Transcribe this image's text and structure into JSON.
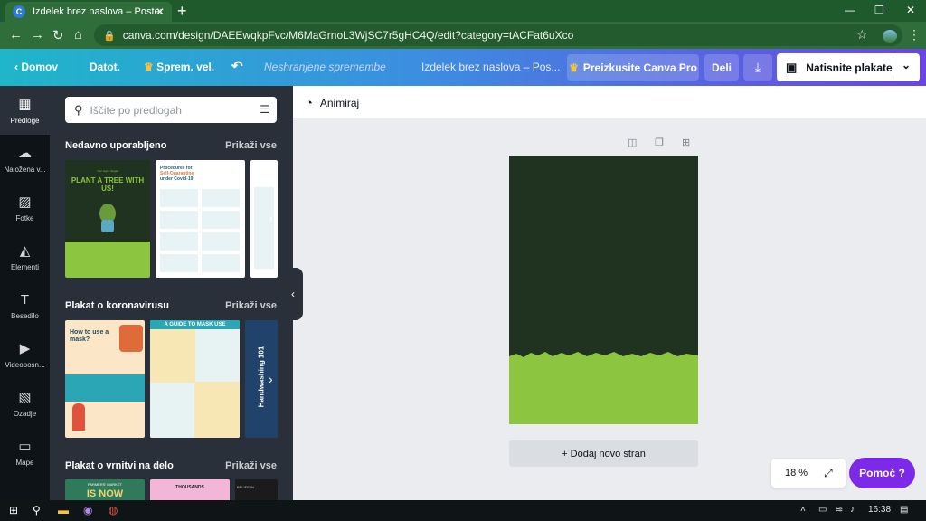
{
  "browser": {
    "tab_title": "Izdelek brez naslova – Poster",
    "tab_favicon": "C",
    "url": "canva.com/design/DAEEwqkpFvc/M6MaGrnoL3WjSC7r5gHC4Q/edit?category=tACFat6uXco",
    "colors": {
      "tabstrip": "#1e5a2c",
      "toolbar": "#2f6e3b"
    }
  },
  "toolbar": {
    "home": "Domov",
    "file": "Datot.",
    "resize": "Sprem. vel.",
    "save_status": "Neshranjene spremembe",
    "doc_title": "Izdelek brez naslova – Pos...",
    "try_pro": "Preizkusite Canva Pro",
    "share": "Deli",
    "print": "Natisnite plakate"
  },
  "rail": [
    {
      "label": "Predloge",
      "icon": "templates-icon"
    },
    {
      "label": "Naložena v...",
      "icon": "upload-cloud-icon"
    },
    {
      "label": "Fotke",
      "icon": "photo-icon"
    },
    {
      "label": "Elementi",
      "icon": "elements-icon"
    },
    {
      "label": "Besedilo",
      "icon": "text-icon"
    },
    {
      "label": "Videoposn...",
      "icon": "video-icon"
    },
    {
      "label": "Ozadje",
      "icon": "background-icon"
    },
    {
      "label": "Mape",
      "icon": "folder-icon"
    }
  ],
  "panel": {
    "search_placeholder": "Iščite po predlogah",
    "sections": [
      {
        "title": "Nedavno uporabljeno",
        "show_all": "Prikaži vse"
      },
      {
        "title": "Plakat o koronavirusu",
        "show_all": "Prikaži vse"
      },
      {
        "title": "Plakat o vrnitvi na delo",
        "show_all": "Prikaži vse"
      }
    ],
    "thumbs": {
      "tree_tag": "Your logo / slogan",
      "tree_title": "PLANT A TREE WITH US!",
      "covid_title": "Procedures for",
      "covid_title2": "Self-Quarantine",
      "covid_title3": "under Covid-19",
      "mask_title": "How to use a mask?",
      "guide_title": "A GUIDE TO MASK USE",
      "hand_title": "Handwashing 101",
      "work1": "IS NOW",
      "work1_tag": "FARMERS' MARKET",
      "work2": "THOUSANDS",
      "work3": "BELIEF IN"
    }
  },
  "canvas": {
    "animate": "Animiraj",
    "add_page": "+ Dodaj novo stran",
    "zoom": "18 %",
    "help": "Pomoč ?",
    "colors": {
      "page_dark": "#1f3320",
      "page_green": "#8cc53f"
    }
  },
  "taskbar": {
    "time": "16:38"
  }
}
